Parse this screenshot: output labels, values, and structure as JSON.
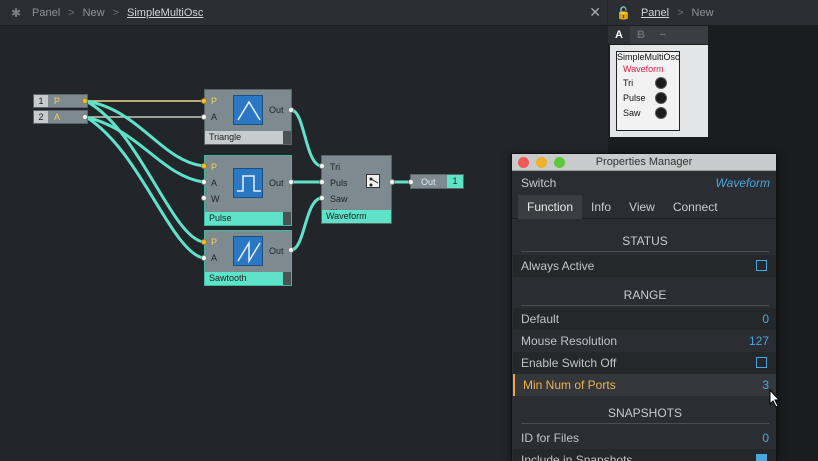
{
  "editor": {
    "breadcrumb": [
      "Panel",
      "New",
      "SimpleMultiOsc"
    ],
    "close_glyph": "✕"
  },
  "inputs": [
    {
      "num": "1",
      "label": "P"
    },
    {
      "num": "2",
      "label": "A"
    }
  ],
  "modules": {
    "triangle": {
      "title": "Triangle",
      "ports_in": [
        "P",
        "A"
      ],
      "port_out": "Out"
    },
    "pulse": {
      "title": "Pulse",
      "ports_in": [
        "P",
        "A",
        "W"
      ],
      "port_out": "Out"
    },
    "sawtooth": {
      "title": "Sawtooth",
      "ports_in": [
        "P",
        "A"
      ],
      "port_out": "Out"
    },
    "waveform": {
      "title": "Waveform",
      "ports_in": [
        "Tri",
        "Puls",
        "Saw"
      ],
      "extra": "..."
    },
    "output": {
      "label": "Out",
      "num": "1"
    }
  },
  "panel_view": {
    "breadcrumb": [
      "Panel",
      "New"
    ],
    "toolbar": [
      "A",
      "B",
      "−"
    ],
    "ensemble_title": "SimpleMultiOsc",
    "waveform_label": "Waveform",
    "rows": [
      "Tri",
      "Pulse",
      "Saw"
    ]
  },
  "properties": {
    "window_title": "Properties Manager",
    "module_type": "Switch",
    "module_name": "Waveform",
    "tabs": [
      "Function",
      "Info",
      "View",
      "Connect"
    ],
    "sections": {
      "status": "STATUS",
      "range": "RANGE",
      "snapshots": "SNAPSHOTS"
    },
    "rows": {
      "always_active": {
        "label": "Always Active",
        "checked": false
      },
      "default": {
        "label": "Default",
        "value": "0"
      },
      "mouse_resolution": {
        "label": "Mouse Resolution",
        "value": "127"
      },
      "enable_switch_off": {
        "label": "Enable Switch Off",
        "checked": false
      },
      "min_num_ports": {
        "label": "Min Num of Ports",
        "value": "3"
      },
      "id_for_files": {
        "label": "ID for Files",
        "value": "0"
      },
      "include_in_snapshots": {
        "label": "Include in Snapshots",
        "checked": true
      }
    }
  },
  "colors": {
    "wire": "#5fe3c8",
    "accent_blue": "#4aa6e0",
    "highlight_orange": "#f0b050"
  }
}
